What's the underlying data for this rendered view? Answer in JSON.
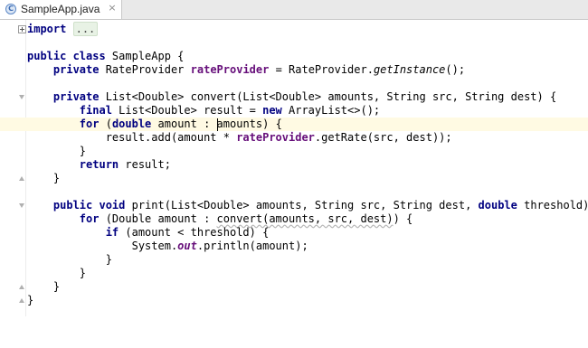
{
  "tab": {
    "icon_letter": "C",
    "title": "SampleApp.java",
    "close": "×"
  },
  "code": {
    "import_kw": "import",
    "import_folded": "...",
    "l3": {
      "kw": "public class",
      "rest": " SampleApp {"
    },
    "l4": {
      "kw": "private",
      "type": " RateProvider ",
      "field": "rateProvider",
      "mid": " = RateProvider.",
      "call": "getInstance",
      "end": "();"
    },
    "l6": {
      "kw": "private",
      "rest": " List<Double> convert(List<Double> amounts, String src, String dest) {"
    },
    "l7": {
      "kw1": "final",
      "mid": " List<Double> result = ",
      "kw2": "new",
      "end": " ArrayList<>();"
    },
    "l8": {
      "kw1": "for",
      "mid1": " (",
      "kw2": "double",
      "mid2": " amount : ",
      "caret_after": "",
      "var": "amounts",
      "end": ") {"
    },
    "l9": {
      "pre": "result.add(amount * ",
      "field": "rateProvider",
      "end": ".getRate(src, dest));"
    },
    "l10": {
      "rest": "}"
    },
    "l11": {
      "kw": "return",
      "rest": " result;"
    },
    "l12": {
      "rest": "}"
    },
    "l14": {
      "kw1": "public void",
      "mid": " print(List<Double> amounts, String src, String dest, ",
      "kw2": "double",
      "end": " threshold) {"
    },
    "l15": {
      "kw": "for",
      "mid": " (Double amount : ",
      "squiggle": "convert(amounts, src, dest)",
      "end": ") {"
    },
    "l16": {
      "kw": "if",
      "rest": " (amount < threshold) {"
    },
    "l17": {
      "pre": "System.",
      "field": "out",
      "end": ".println(amount);"
    },
    "l18": {
      "rest": "}"
    },
    "l19": {
      "rest": "}"
    },
    "l20": {
      "rest": "}"
    },
    "l21": {
      "rest": "}"
    }
  },
  "colors": {
    "keyword": "#000080",
    "field": "#660e7a",
    "current_line": "#fffae3"
  }
}
